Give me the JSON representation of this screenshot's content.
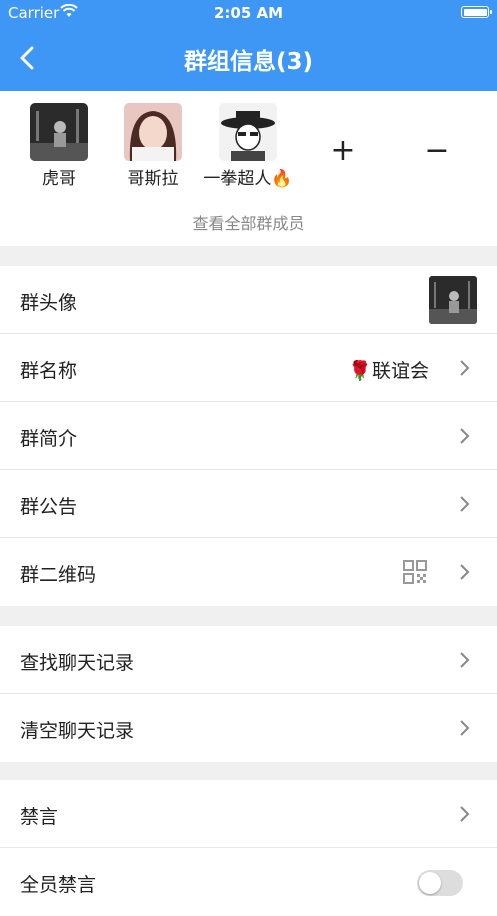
{
  "status_bar": {
    "carrier": "Carrier",
    "time": "2:05 AM"
  },
  "header": {
    "title": "群组信息(3)"
  },
  "members": [
    {
      "name": "虎哥"
    },
    {
      "name": "哥斯拉"
    },
    {
      "name": "一拳超人🔥"
    }
  ],
  "actions": {
    "add": "+",
    "remove": "−"
  },
  "view_all": "查看全部群成员",
  "settings": {
    "avatar_label": "群头像",
    "name_label": "群名称",
    "name_value": "🌹联谊会",
    "intro_label": "群简介",
    "notice_label": "群公告",
    "qrcode_label": "群二维码"
  },
  "chat": {
    "search_label": "查找聊天记录",
    "clear_label": "清空聊天记录"
  },
  "mute": {
    "mute_label": "禁言",
    "mute_all_label": "全员禁言",
    "mute_all_on": false
  },
  "colors": {
    "header": "#3f97f5",
    "background": "#f0f0f0"
  }
}
